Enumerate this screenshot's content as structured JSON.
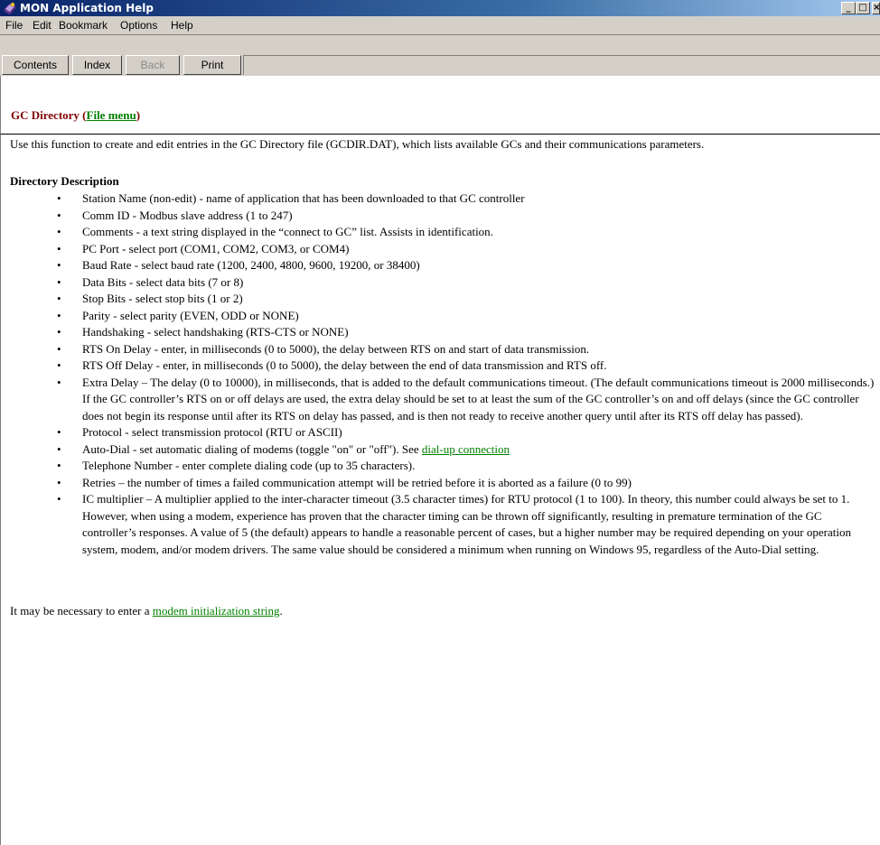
{
  "window": {
    "title": "MON Application Help",
    "controls": {
      "minimize": "_",
      "maximize": "□",
      "close": "×"
    }
  },
  "menu": {
    "file": "File",
    "edit": "Edit",
    "bookmark": "Bookmark",
    "options": "Options",
    "help": "Help"
  },
  "toolbar": {
    "contents": "Contents",
    "index": "Index",
    "back": "Back",
    "print": "Print"
  },
  "topic": {
    "title_prefix": "GC Directory (",
    "title_link": "File menu",
    "title_suffix": ")"
  },
  "content": {
    "intro": "Use this function to create and edit entries in the GC Directory file (GCDIR.DAT), which lists available GCs and their communications parameters.",
    "section_heading": "Directory Description",
    "items": [
      {
        "text": "Station Name (non-edit) - name of application that has been downloaded to that GC controller"
      },
      {
        "text": "Comm ID - Modbus slave address (1 to 247)"
      },
      {
        "text": "Comments - a text string displayed in the “connect to GC” list.  Assists in identification."
      },
      {
        "text": "PC Port - select port (COM1, COM2, COM3, or COM4)"
      },
      {
        "text": "Baud Rate - select baud rate (1200, 2400, 4800, 9600, 19200, or 38400)"
      },
      {
        "text": "Data Bits - select data bits (7 or 8)"
      },
      {
        "text": "Stop Bits - select stop bits (1 or 2)"
      },
      {
        "text": "Parity - select parity (EVEN, ODD or NONE)"
      },
      {
        "text": "Handshaking - select handshaking (RTS-CTS or NONE)"
      },
      {
        "text": "RTS On Delay - enter, in milliseconds (0 to 5000), the delay between RTS on and start of data transmission."
      },
      {
        "text": "RTS Off Delay - enter, in milliseconds (0 to 5000), the delay between the end of data transmission and RTS off."
      },
      {
        "text": "Extra Delay – The delay (0 to 10000), in milliseconds, that is added to the default communications timeout.  (The default communications timeout is 2000 milliseconds.)  If the GC controller’s RTS on or off delays are used, the extra delay should be set to at least the sum of the GC controller’s on and off delays (since the GC controller does not begin its response until after its RTS on delay has passed, and is then not ready to receive another query until after its RTS off delay has passed)."
      },
      {
        "text": "Protocol - select transmission protocol (RTU or ASCII)"
      },
      {
        "text": "Auto-Dial - set automatic dialing of modems (toggle \"on\" or \"off\"). See ",
        "link": "dial-up connection"
      },
      {
        "text": "Telephone Number - enter complete dialing code (up to 35 characters)."
      },
      {
        "text": "Retries – the number of times a failed communication attempt will be retried before it is aborted as a failure (0 to 99)"
      },
      {
        "text": "IC multiplier – A multiplier applied to the inter-character timeout (3.5 character times) for RTU protocol (1 to 100).  In theory, this number could always be set to 1.  However, when using a modem, experience has proven that the character timing can be thrown off significantly, resulting in premature termination of the GC controller’s responses.  A value of 5 (the default) appears to handle a reasonable percent of cases, but a higher number may be required depending on your operation system, modem, and/or modem drivers.  The same value should be considered a minimum when running on Windows 95, regardless of the Auto-Dial setting."
      }
    ],
    "footer_prefix": "It may be necessary to enter a ",
    "footer_link": "modem initialization string",
    "footer_suffix": "."
  },
  "colors": {
    "title_bar": "#0a246a",
    "topic_title": "#800000",
    "link": "#008000",
    "chrome": "#d4d0c8"
  },
  "icons": {
    "app": "help-book-icon"
  }
}
